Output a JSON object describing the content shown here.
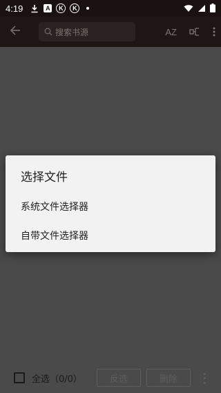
{
  "status_bar": {
    "time": "4:19",
    "icons": [
      "download-icon",
      "a-box-icon",
      "k-circle-icon",
      "k-circle-icon",
      "dot-icon"
    ],
    "right_icons": [
      "wifi-icon",
      "signal-icon",
      "battery-icon"
    ],
    "badge_a": "A",
    "badge_k": "K"
  },
  "toolbar": {
    "search_placeholder": "搜索书源",
    "sort_label": "AZ"
  },
  "dialog": {
    "title": "选择文件",
    "items": [
      {
        "label": "系统文件选择器"
      },
      {
        "label": "自带文件选择器"
      }
    ]
  },
  "bottom_bar": {
    "select_all_label": "全选（0/0）",
    "invert_label": "反选",
    "delete_label": "删除"
  },
  "colors": {
    "scrim": "#4a4a4a",
    "toolbar": "#1e1614",
    "status_bar": "#1a1210",
    "dialog_bg": "#f2f2f2"
  }
}
